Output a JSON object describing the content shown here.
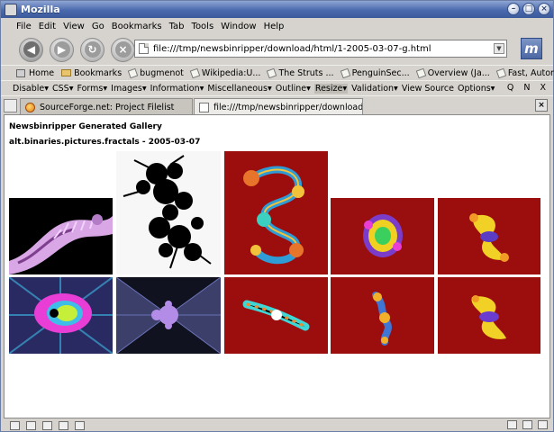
{
  "window": {
    "title": "Mozilla"
  },
  "menu": [
    "File",
    "Edit",
    "View",
    "Go",
    "Bookmarks",
    "Tab",
    "Tools",
    "Window",
    "Help"
  ],
  "nav": {
    "url": "file:///tmp/newsbinripper/download/html/1-2005-03-07-g.html"
  },
  "bookmarks": [
    {
      "label": "Home",
      "icon": "home-icon"
    },
    {
      "label": "Bookmarks",
      "icon": "folder-icon"
    },
    {
      "label": "bugmenot",
      "icon": "bookmark-icon"
    },
    {
      "label": "Wikipedia:U...",
      "icon": "bookmark-icon"
    },
    {
      "label": "The Struts ...",
      "icon": "bookmark-icon"
    },
    {
      "label": "PenguinSec...",
      "icon": "bookmark-icon"
    },
    {
      "label": "Overview (Ja...",
      "icon": "bookmark-icon"
    },
    {
      "label": "Fast, Autom...",
      "icon": "bookmark-icon"
    }
  ],
  "devtools": [
    "Disable▾",
    "CSS▾",
    "Forms▾",
    "Images▾",
    "Information▾",
    "Miscellaneous▾",
    "Outline▾",
    "Resize▾",
    "Validation▾",
    "View Source",
    "Options▾"
  ],
  "devtools_right": "Q N X",
  "tabs": [
    {
      "label": "SourceForge.net: Project Filelist",
      "active": false
    },
    {
      "label": "file:///tmp/newsbinripper/download/...",
      "active": true
    }
  ],
  "page": {
    "title": "Newsbinripper Generated Gallery",
    "subtitle": "alt.binaries.pictures.fractals - 2005-03-07",
    "thumbnails": [
      {
        "name": "fractal-thumb-1",
        "style": "pink-spiral",
        "colors": [
          "#000000",
          "#d9a6e6",
          "#7e3f8f"
        ]
      },
      {
        "name": "fractal-thumb-2",
        "style": "julia-bw",
        "colors": [
          "#f7f7f7",
          "#000000"
        ]
      },
      {
        "name": "fractal-thumb-3",
        "style": "ornate-red",
        "colors": [
          "#9c0e0e",
          "#f2c23a",
          "#2f9cd6"
        ]
      },
      {
        "name": "fractal-thumb-4",
        "style": "rainbow-blob",
        "colors": [
          "#990f0f",
          "#f0d020",
          "#7b3cc9",
          "#3bd05d"
        ]
      },
      {
        "name": "fractal-thumb-5",
        "style": "yellow-julia",
        "colors": [
          "#9c0e0e",
          "#f2d126",
          "#5b3cc4"
        ]
      },
      {
        "name": "fractal-thumb-6",
        "style": "neon-mandel",
        "colors": [
          "#2a2a62",
          "#e83ed6",
          "#c6ef3a",
          "#3dbde8"
        ]
      },
      {
        "name": "fractal-thumb-7",
        "style": "violet-mandel",
        "colors": [
          "#3b3f6a",
          "#b38ce8",
          "#7f8ad9"
        ]
      },
      {
        "name": "fractal-thumb-8",
        "style": "teal-swirl",
        "colors": [
          "#9c0e0e",
          "#3fd6d6",
          "#f08a2a"
        ]
      },
      {
        "name": "fractal-thumb-9",
        "style": "small-flame",
        "colors": [
          "#9c0e0e",
          "#3f76d6",
          "#f2b02a"
        ]
      },
      {
        "name": "fractal-thumb-10",
        "style": "yellow-julia-2",
        "colors": [
          "#9c0e0e",
          "#f2d126",
          "#6a3cd0"
        ]
      }
    ]
  }
}
